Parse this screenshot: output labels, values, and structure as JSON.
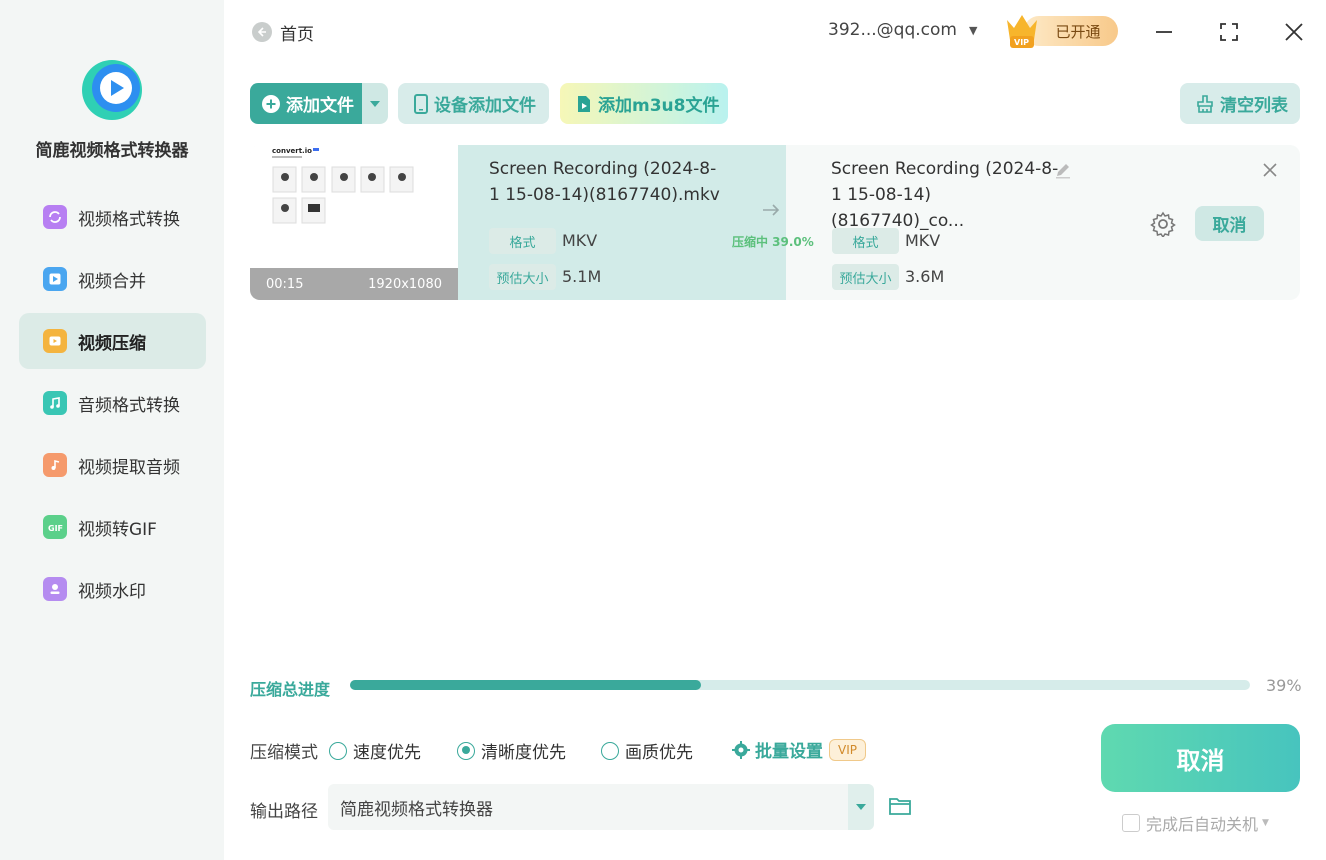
{
  "app": {
    "name": "简鹿视频格式转换器"
  },
  "sidebar": {
    "items": [
      {
        "label": "视频格式转换",
        "icon": "convert-icon",
        "color": "#b77ff2",
        "active": false
      },
      {
        "label": "视频合并",
        "icon": "merge-icon",
        "color": "#4aa6f0",
        "active": false
      },
      {
        "label": "视频压缩",
        "icon": "compress-icon",
        "color": "#f4b43f",
        "active": true
      },
      {
        "label": "音频格式转换",
        "icon": "audio-convert-icon",
        "color": "#39c6b4",
        "active": false
      },
      {
        "label": "视频提取音频",
        "icon": "extract-audio-icon",
        "color": "#f59a6c",
        "active": false
      },
      {
        "label": "视频转GIF",
        "icon": "gif-icon",
        "color": "#5bd08a",
        "active": false
      },
      {
        "label": "视频水印",
        "icon": "watermark-icon",
        "color": "#b58cf0",
        "active": false
      }
    ]
  },
  "header": {
    "back_label": "首页",
    "account": "392...@qq.com",
    "vip_status": "已开通"
  },
  "toolbar": {
    "add_file": "添加文件",
    "device_add": "设备添加文件",
    "add_m3u8": "添加m3u8文件",
    "clear_list": "清空列表"
  },
  "file": {
    "thumb_duration": "00:15",
    "thumb_resolution": "1920x1080",
    "thumb_site": "convert.io",
    "source_name_line1": "Screen Recording (2024-8-",
    "source_name_line2": "1 15-08-14)(8167740).mkv",
    "output_name_line1": "Screen Recording (2024-8-",
    "output_name_line2": "1 15-08-14)(8167740)_co...",
    "format_label": "格式",
    "size_label": "预估大小",
    "source_format": "MKV",
    "source_size": "5.1M",
    "output_format": "MKV",
    "output_size": "3.6M",
    "status": "压缩中 39.0%",
    "progress": 0.39,
    "cancel_label": "取消"
  },
  "progress": {
    "label": "压缩总进度",
    "percent_text": "39%",
    "value": 0.39
  },
  "mode": {
    "label": "压缩模式",
    "options": [
      "速度优先",
      "清晰度优先",
      "画质优先"
    ],
    "selected_index": 1,
    "batch_label": "批量设置",
    "vip_tag": "VIP"
  },
  "output": {
    "label": "输出路径",
    "path": "简鹿视频格式转换器"
  },
  "actions": {
    "cancel_label": "取消",
    "shutdown_label": "完成后自动关机"
  },
  "colors": {
    "accent": "#3aa99b",
    "accent_light": "#d6ecea",
    "status_green": "#5cc07c"
  }
}
